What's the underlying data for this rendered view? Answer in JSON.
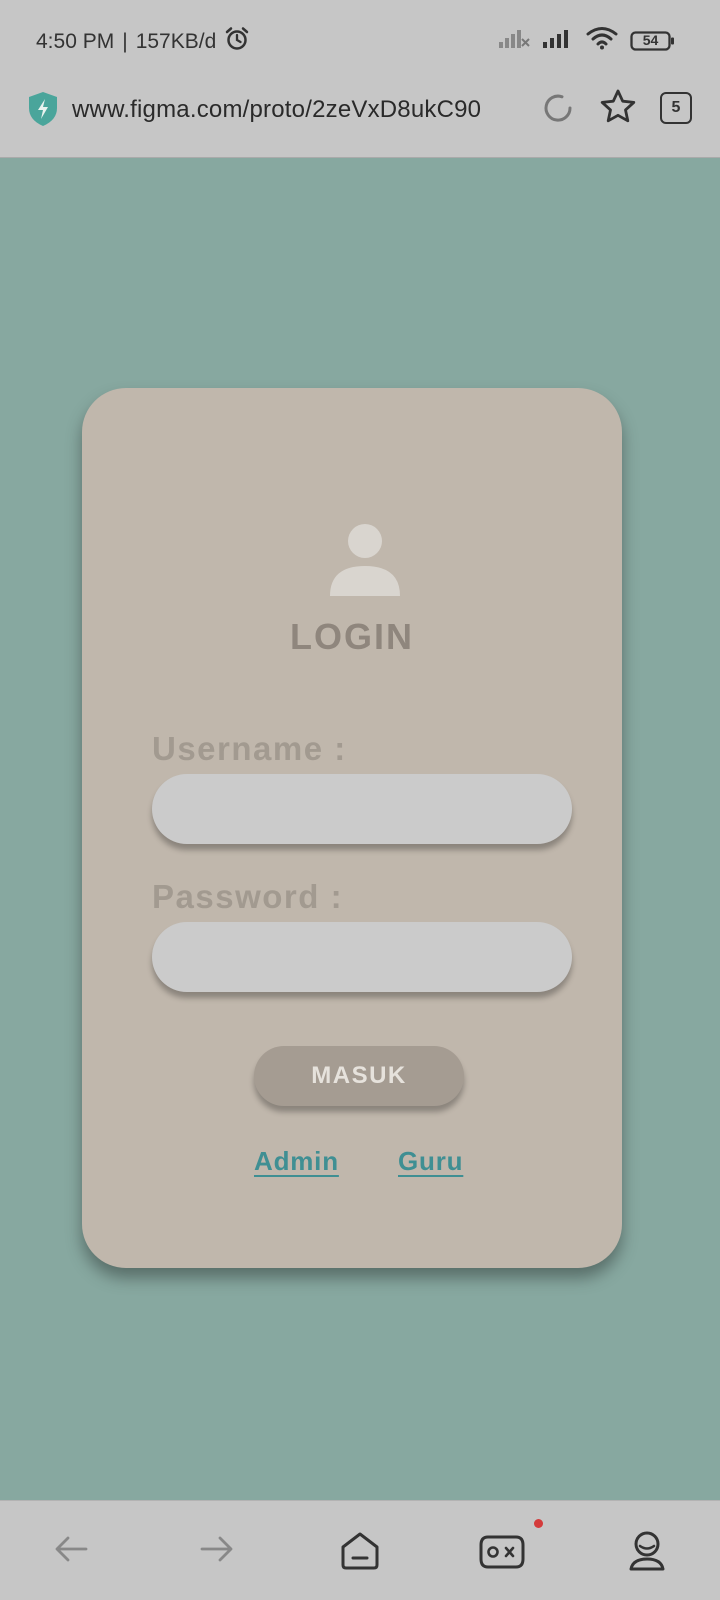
{
  "status_bar": {
    "time": "4:50 PM",
    "separator": "|",
    "data_rate": "157KB/d",
    "battery": "54",
    "icons": [
      "alarm-icon",
      "signal-off-icon",
      "signal-icon",
      "wifi-icon",
      "battery-icon"
    ]
  },
  "browser": {
    "url": "www.figma.com/proto/2zeVxD8ukC90",
    "tab_count": "5",
    "icons": [
      "shield-icon",
      "reload-icon",
      "star-icon",
      "tabs-icon"
    ]
  },
  "login": {
    "title": "LOGIN",
    "username_label": "Username :",
    "username_value": "",
    "password_label": "Password :",
    "password_value": "",
    "submit_label": "MASUK",
    "links": [
      "Admin",
      "Guru"
    ]
  },
  "bottom_nav": {
    "icons": [
      "back-arrow-icon",
      "forward-arrow-icon",
      "home-icon",
      "games-icon",
      "profile-icon"
    ],
    "notification_dot": true
  },
  "colors": {
    "background": "#87a8a0",
    "card": "#c0b7ac",
    "button": "#a59c92",
    "link": "#3f8f93",
    "notification": "#d43b3b"
  }
}
